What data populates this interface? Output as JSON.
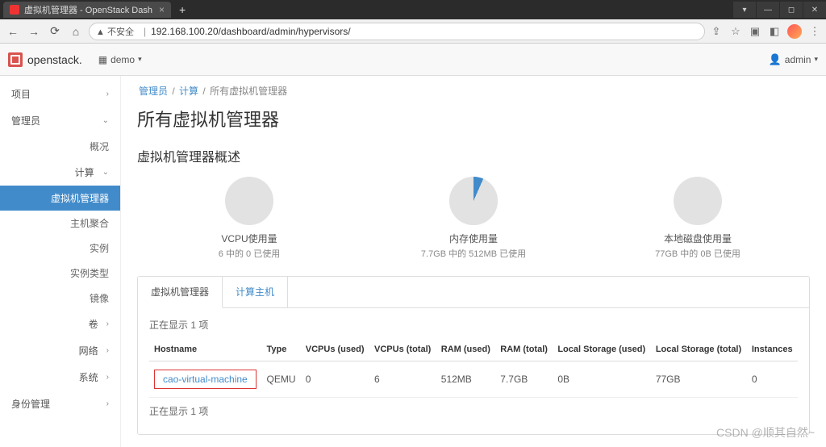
{
  "browser": {
    "tab_title": "虚拟机管理器 - OpenStack Dash",
    "url_warning": "▲ 不安全",
    "url": "192.168.100.20/dashboard/admin/hypervisors/"
  },
  "header": {
    "brand": "openstack.",
    "project_prefix": "",
    "project": "demo",
    "user": "admin"
  },
  "sidebar": {
    "project": "项目",
    "admin": "管理员",
    "overview": "概况",
    "compute": "计算",
    "hypervisors": "虚拟机管理器",
    "host_agg": "主机聚合",
    "instances": "实例",
    "flavors": "实例类型",
    "images": "镜像",
    "volumes": "卷",
    "network": "网络",
    "system": "系统",
    "identity": "身份管理"
  },
  "breadcrumbs": {
    "admin": "管理员",
    "compute": "计算",
    "current": "所有虚拟机管理器"
  },
  "page_title": "所有虚拟机管理器",
  "sub_title": "虚拟机管理器概述",
  "chart_data": [
    {
      "type": "pie",
      "title": "VCPU使用量",
      "subtitle": "6 中的 0 已使用",
      "used": 0,
      "total": 6,
      "percent": 0
    },
    {
      "type": "pie",
      "title": "内存使用量",
      "subtitle": "7.7GB 中的 512MB 已使用",
      "used_label": "512MB",
      "total_label": "7.7GB",
      "percent": 6.5
    },
    {
      "type": "pie",
      "title": "本地磁盘使用量",
      "subtitle": "77GB 中的 0B 已使用",
      "used_label": "0B",
      "total_label": "77GB",
      "percent": 0
    }
  ],
  "tabs": {
    "hypervisor": "虚拟机管理器",
    "compute_host": "计算主机"
  },
  "showing_text": "正在显示 1 项",
  "table": {
    "headers": {
      "hostname": "Hostname",
      "type": "Type",
      "vcpus_used": "VCPUs (used)",
      "vcpus_total": "VCPUs (total)",
      "ram_used": "RAM (used)",
      "ram_total": "RAM (total)",
      "local_used": "Local Storage (used)",
      "local_total": "Local Storage (total)",
      "instances": "Instances"
    },
    "rows": [
      {
        "hostname": "cao-virtual-machine",
        "type": "QEMU",
        "vcpus_used": "0",
        "vcpus_total": "6",
        "ram_used": "512MB",
        "ram_total": "7.7GB",
        "local_used": "0B",
        "local_total": "77GB",
        "instances": "0"
      }
    ]
  },
  "watermark": "CSDN @顺其自然~"
}
